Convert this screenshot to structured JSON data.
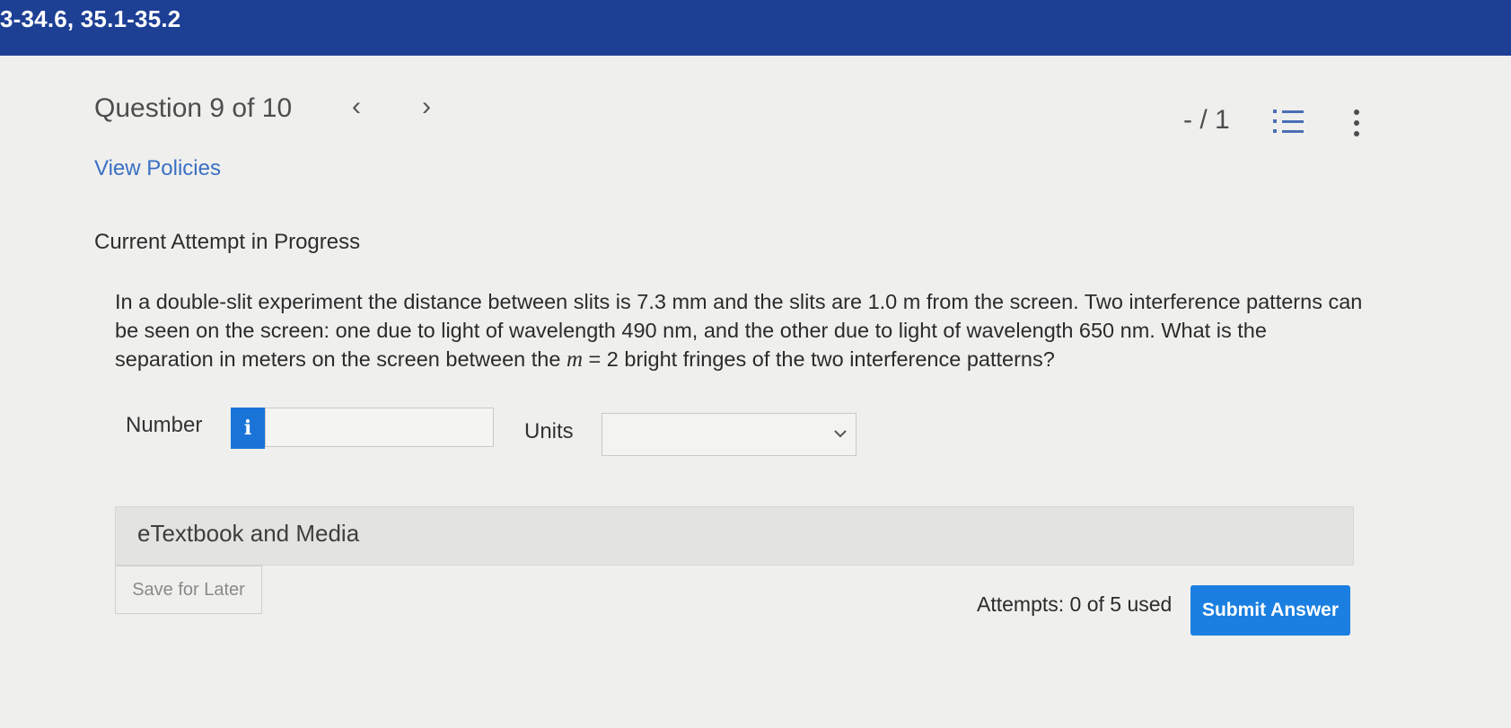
{
  "header": {
    "breadcrumb": "3-34.6, 35.1-35.2",
    "bar_color": "#1d3f94"
  },
  "question_nav": {
    "title": "Question 9 of 10",
    "prev_icon": "chevron-left-icon",
    "next_icon": "chevron-right-icon",
    "score": "- / 1",
    "list_icon": "numbered-list-icon",
    "more_icon": "vertical-ellipsis-icon"
  },
  "policies_link": "View Policies",
  "attempt_heading": "Current Attempt in Progress",
  "question": {
    "text_1": "In a double-slit experiment the distance between slits is 7.3 mm and the slits are 1.0 m from the screen. Two interference patterns can be seen on the screen: one due to light of wavelength 490 nm, and the other due to light of wavelength 650 nm. What is the separation in meters on the screen between the ",
    "variable": "m",
    "text_2": " = 2 bright fringes of the two interference patterns?"
  },
  "answer": {
    "number_label": "Number",
    "info_icon": "info-icon",
    "info_glyph": "i",
    "number_value": "",
    "units_label": "Units",
    "units_selected": "",
    "units_icon": "chevron-down-icon"
  },
  "etextbook_label": "eTextbook and Media",
  "footer": {
    "save_label": "Save for Later",
    "attempts_text": "Attempts: 0 of 5 used",
    "submit_label": "Submit Answer",
    "submit_color": "#1a7fe0"
  }
}
